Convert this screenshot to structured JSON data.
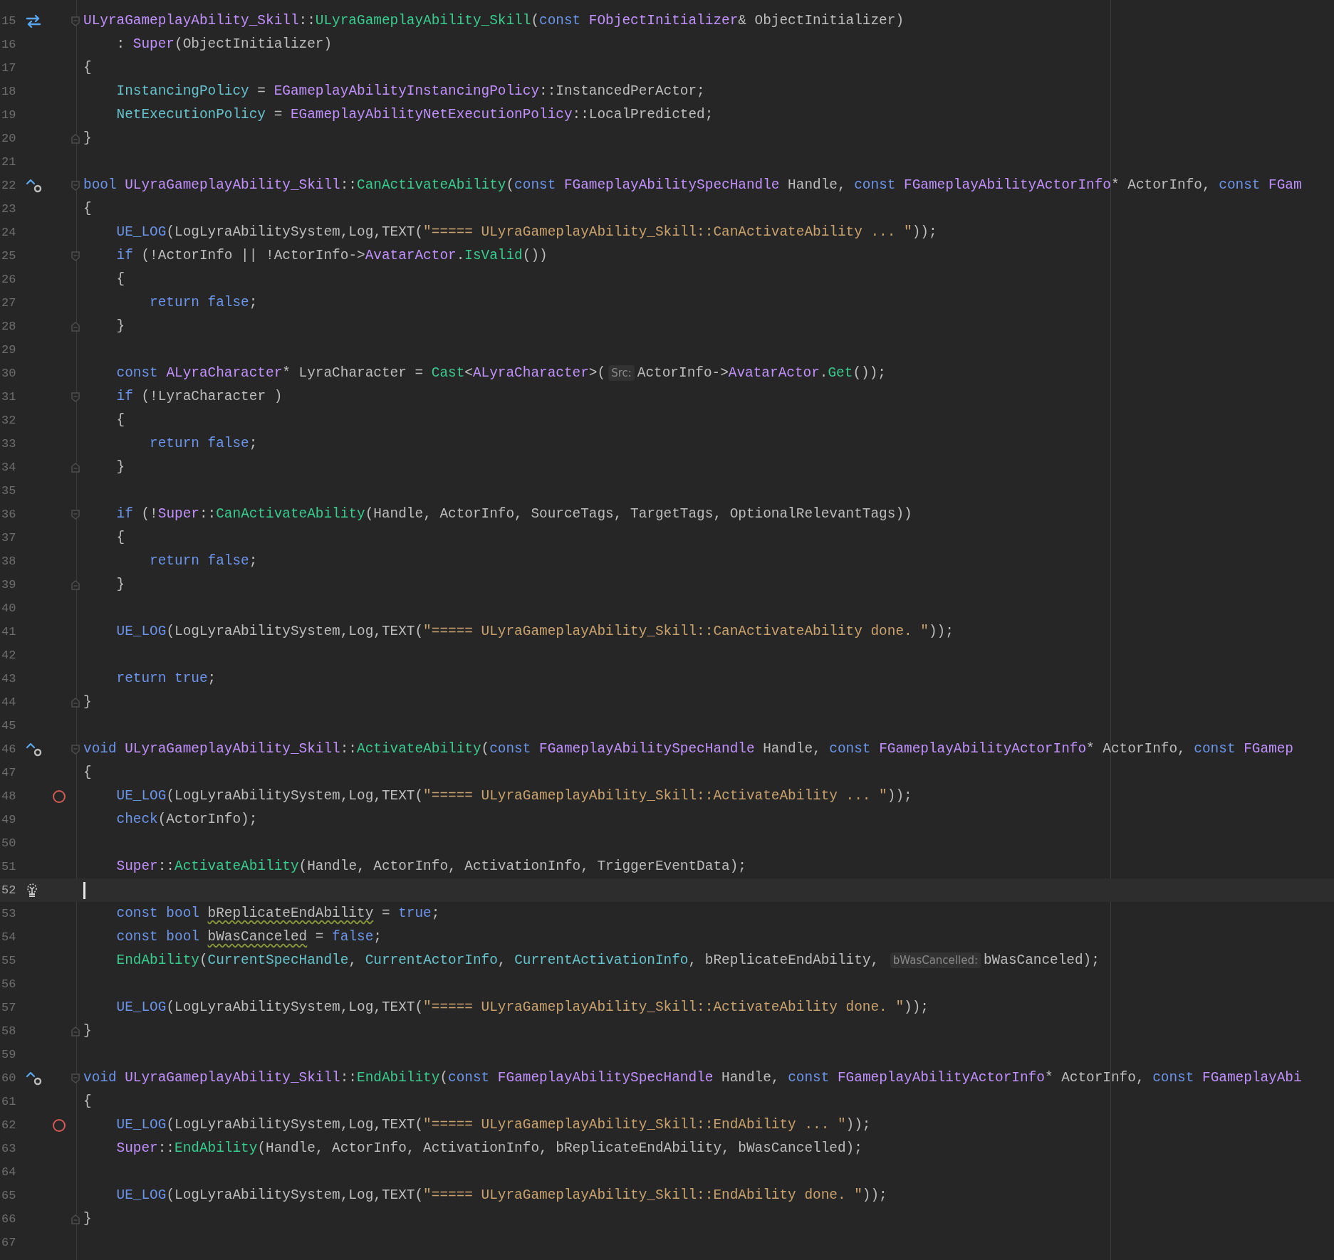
{
  "editor": {
    "lines": [
      {
        "number": "15",
        "gutter_icon": {
          "kind": "swap"
        },
        "fold": {
          "kind": "start"
        },
        "tokens": [
          {
            "kind": "cls",
            "text": "ULyraGameplayAbility_Skill"
          },
          {
            "kind": "plain",
            "text": "::"
          },
          {
            "kind": "fn",
            "text": "ULyraGameplayAbility_Skill"
          },
          {
            "kind": "plain",
            "text": "("
          },
          {
            "kind": "kw",
            "text": "const "
          },
          {
            "kind": "cls",
            "text": "FObjectInitializer"
          },
          {
            "kind": "plain",
            "text": "& ObjectInitializer)"
          }
        ]
      },
      {
        "number": "16",
        "tokens": [
          {
            "kind": "plain",
            "text": "    : "
          },
          {
            "kind": "cls",
            "text": "Super"
          },
          {
            "kind": "plain",
            "text": "(ObjectInitializer)"
          }
        ]
      },
      {
        "number": "17",
        "tokens": [
          {
            "kind": "plain",
            "text": "{"
          }
        ]
      },
      {
        "number": "18",
        "tokens": [
          {
            "kind": "field",
            "text": "    InstancingPolicy"
          },
          {
            "kind": "plain",
            "text": " = "
          },
          {
            "kind": "cls",
            "text": "EGameplayAbilityInstancingPolicy"
          },
          {
            "kind": "plain",
            "text": "::InstancedPerActor;"
          }
        ]
      },
      {
        "number": "19",
        "tokens": [
          {
            "kind": "field",
            "text": "    NetExecutionPolicy"
          },
          {
            "kind": "plain",
            "text": " = "
          },
          {
            "kind": "cls",
            "text": "EGameplayAbilityNetExecutionPolicy"
          },
          {
            "kind": "plain",
            "text": "::LocalPredicted;"
          }
        ]
      },
      {
        "number": "20",
        "fold": {
          "kind": "end"
        },
        "tokens": [
          {
            "kind": "plain",
            "text": "}"
          }
        ]
      },
      {
        "number": "21"
      },
      {
        "number": "22",
        "gutter_icon": {
          "kind": "override"
        },
        "fold": {
          "kind": "start"
        },
        "tokens": [
          {
            "kind": "kw",
            "text": "bool "
          },
          {
            "kind": "cls",
            "text": "ULyraGameplayAbility_Skill"
          },
          {
            "kind": "plain",
            "text": "::"
          },
          {
            "kind": "fn",
            "text": "CanActivateAbility"
          },
          {
            "kind": "plain",
            "text": "("
          },
          {
            "kind": "kw",
            "text": "const "
          },
          {
            "kind": "cls",
            "text": "FGameplayAbilitySpecHandle"
          },
          {
            "kind": "plain",
            "text": " Handle, "
          },
          {
            "kind": "kw",
            "text": "const "
          },
          {
            "kind": "cls",
            "text": "FGameplayAbilityActorInfo"
          },
          {
            "kind": "plain",
            "text": "* ActorInfo, "
          },
          {
            "kind": "kw",
            "text": "const "
          },
          {
            "kind": "cls",
            "text": "FGam"
          }
        ]
      },
      {
        "number": "23",
        "tokens": [
          {
            "kind": "plain",
            "text": "{"
          }
        ]
      },
      {
        "number": "24",
        "tokens": [
          {
            "kind": "macro",
            "text": "    UE_LOG"
          },
          {
            "kind": "plain",
            "text": "(LogLyraAbilitySystem,Log,TEXT("
          },
          {
            "kind": "str",
            "text": "\"===== ULyraGameplayAbility_Skill::CanActivateAbility ... \""
          },
          {
            "kind": "plain",
            "text": "));"
          }
        ]
      },
      {
        "number": "25",
        "fold": {
          "kind": "start"
        },
        "tokens": [
          {
            "kind": "kw",
            "text": "    if "
          },
          {
            "kind": "plain",
            "text": "(!ActorInfo || !ActorInfo->"
          },
          {
            "kind": "cls",
            "text": "AvatarActor"
          },
          {
            "kind": "plain",
            "text": "."
          },
          {
            "kind": "fn",
            "text": "IsValid"
          },
          {
            "kind": "plain",
            "text": "())"
          }
        ]
      },
      {
        "number": "26",
        "tokens": [
          {
            "kind": "plain",
            "text": "    {"
          }
        ]
      },
      {
        "number": "27",
        "tokens": [
          {
            "kind": "kw",
            "text": "        return false"
          },
          {
            "kind": "plain",
            "text": ";"
          }
        ]
      },
      {
        "number": "28",
        "fold": {
          "kind": "end"
        },
        "tokens": [
          {
            "kind": "plain",
            "text": "    }"
          }
        ]
      },
      {
        "number": "29"
      },
      {
        "number": "30",
        "tokens": [
          {
            "kind": "kw",
            "text": "    const "
          },
          {
            "kind": "cls",
            "text": "ALyraCharacter"
          },
          {
            "kind": "plain",
            "text": "* LyraCharacter = "
          },
          {
            "kind": "fn",
            "text": "Cast"
          },
          {
            "kind": "plain",
            "text": "<"
          },
          {
            "kind": "cls",
            "text": "ALyraCharacter"
          },
          {
            "kind": "plain",
            "text": ">("
          },
          {
            "kind": "hint",
            "text": "Src:"
          },
          {
            "kind": "plain",
            "text": "ActorInfo->"
          },
          {
            "kind": "cls",
            "text": "AvatarActor"
          },
          {
            "kind": "plain",
            "text": "."
          },
          {
            "kind": "fn",
            "text": "Get"
          },
          {
            "kind": "plain",
            "text": "());"
          }
        ]
      },
      {
        "number": "31",
        "fold": {
          "kind": "start"
        },
        "tokens": [
          {
            "kind": "kw",
            "text": "    if "
          },
          {
            "kind": "plain",
            "text": "(!LyraCharacter )"
          }
        ]
      },
      {
        "number": "32",
        "tokens": [
          {
            "kind": "plain",
            "text": "    {"
          }
        ]
      },
      {
        "number": "33",
        "tokens": [
          {
            "kind": "kw",
            "text": "        return false"
          },
          {
            "kind": "plain",
            "text": ";"
          }
        ]
      },
      {
        "number": "34",
        "fold": {
          "kind": "end"
        },
        "tokens": [
          {
            "kind": "plain",
            "text": "    }"
          }
        ]
      },
      {
        "number": "35"
      },
      {
        "number": "36",
        "fold": {
          "kind": "start"
        },
        "tokens": [
          {
            "kind": "kw",
            "text": "    if "
          },
          {
            "kind": "plain",
            "text": "(!"
          },
          {
            "kind": "cls",
            "text": "Super"
          },
          {
            "kind": "plain",
            "text": "::"
          },
          {
            "kind": "fn",
            "text": "CanActivateAbility"
          },
          {
            "kind": "plain",
            "text": "(Handle, ActorInfo, SourceTags, TargetTags, OptionalRelevantTags))"
          }
        ]
      },
      {
        "number": "37",
        "tokens": [
          {
            "kind": "plain",
            "text": "    {"
          }
        ]
      },
      {
        "number": "38",
        "tokens": [
          {
            "kind": "kw",
            "text": "        return false"
          },
          {
            "kind": "plain",
            "text": ";"
          }
        ]
      },
      {
        "number": "39",
        "fold": {
          "kind": "end"
        },
        "tokens": [
          {
            "kind": "plain",
            "text": "    }"
          }
        ]
      },
      {
        "number": "40"
      },
      {
        "number": "41",
        "tokens": [
          {
            "kind": "macro",
            "text": "    UE_LOG"
          },
          {
            "kind": "plain",
            "text": "(LogLyraAbilitySystem,Log,TEXT("
          },
          {
            "kind": "str",
            "text": "\"===== ULyraGameplayAbility_Skill::CanActivateAbility done. \""
          },
          {
            "kind": "plain",
            "text": "));"
          }
        ]
      },
      {
        "number": "42"
      },
      {
        "number": "43",
        "tokens": [
          {
            "kind": "kw",
            "text": "    return true"
          },
          {
            "kind": "plain",
            "text": ";"
          }
        ]
      },
      {
        "number": "44",
        "fold": {
          "kind": "end"
        },
        "tokens": [
          {
            "kind": "plain",
            "text": "}"
          }
        ]
      },
      {
        "number": "45"
      },
      {
        "number": "46",
        "gutter_icon": {
          "kind": "override"
        },
        "fold": {
          "kind": "start"
        },
        "tokens": [
          {
            "kind": "kw",
            "text": "void "
          },
          {
            "kind": "cls",
            "text": "ULyraGameplayAbility_Skill"
          },
          {
            "kind": "plain",
            "text": "::"
          },
          {
            "kind": "fn",
            "text": "ActivateAbility"
          },
          {
            "kind": "plain",
            "text": "("
          },
          {
            "kind": "kw",
            "text": "const "
          },
          {
            "kind": "cls",
            "text": "FGameplayAbilitySpecHandle"
          },
          {
            "kind": "plain",
            "text": " Handle, "
          },
          {
            "kind": "kw",
            "text": "const "
          },
          {
            "kind": "cls",
            "text": "FGameplayAbilityActorInfo"
          },
          {
            "kind": "plain",
            "text": "* ActorInfo, "
          },
          {
            "kind": "kw",
            "text": "const "
          },
          {
            "kind": "cls",
            "text": "FGamep"
          }
        ]
      },
      {
        "number": "47",
        "tokens": [
          {
            "kind": "plain",
            "text": "{"
          }
        ]
      },
      {
        "number": "48",
        "gutter_icon": {
          "kind": "breakpoint"
        },
        "tokens": [
          {
            "kind": "macro",
            "text": "    UE_LOG"
          },
          {
            "kind": "plain",
            "text": "(LogLyraAbilitySystem,Log,TEXT("
          },
          {
            "kind": "str",
            "text": "\"===== ULyraGameplayAbility_Skill::ActivateAbility ... \""
          },
          {
            "kind": "plain",
            "text": "));"
          }
        ]
      },
      {
        "number": "49",
        "tokens": [
          {
            "kind": "macro",
            "text": "    check"
          },
          {
            "kind": "plain",
            "text": "(ActorInfo);"
          }
        ]
      },
      {
        "number": "50"
      },
      {
        "number": "51",
        "tokens": [
          {
            "kind": "cls",
            "text": "    Super"
          },
          {
            "kind": "plain",
            "text": "::"
          },
          {
            "kind": "fn",
            "text": "ActivateAbility"
          },
          {
            "kind": "plain",
            "text": "(Handle, ActorInfo, ActivationInfo, TriggerEventData);"
          }
        ]
      },
      {
        "number": "52",
        "gutter_icon": {
          "kind": "bulb"
        },
        "current": true
      },
      {
        "number": "53",
        "tokens": [
          {
            "kind": "kw",
            "text": "    const bool "
          },
          {
            "kind": "warn",
            "text": "bReplicateEndAbility"
          },
          {
            "kind": "plain",
            "text": " = "
          },
          {
            "kind": "kw",
            "text": "true"
          },
          {
            "kind": "plain",
            "text": ";"
          }
        ]
      },
      {
        "number": "54",
        "tokens": [
          {
            "kind": "kw",
            "text": "    const bool "
          },
          {
            "kind": "warn",
            "text": "bWasCanceled"
          },
          {
            "kind": "plain",
            "text": " = "
          },
          {
            "kind": "kw",
            "text": "false"
          },
          {
            "kind": "plain",
            "text": ";"
          }
        ]
      },
      {
        "number": "55",
        "tokens": [
          {
            "kind": "fn",
            "text": "    EndAbility"
          },
          {
            "kind": "plain",
            "text": "("
          },
          {
            "kind": "field",
            "text": "CurrentSpecHandle"
          },
          {
            "kind": "plain",
            "text": ", "
          },
          {
            "kind": "field",
            "text": "CurrentActorInfo"
          },
          {
            "kind": "plain",
            "text": ", "
          },
          {
            "kind": "field",
            "text": "CurrentActivationInfo"
          },
          {
            "kind": "plain",
            "text": ", bReplicateEndAbility, "
          },
          {
            "kind": "hint",
            "text": "bWasCancelled:"
          },
          {
            "kind": "plain",
            "text": "bWasCanceled);"
          }
        ]
      },
      {
        "number": "56"
      },
      {
        "number": "57",
        "tokens": [
          {
            "kind": "macro",
            "text": "    UE_LOG"
          },
          {
            "kind": "plain",
            "text": "(LogLyraAbilitySystem,Log,TEXT("
          },
          {
            "kind": "str",
            "text": "\"===== ULyraGameplayAbility_Skill::ActivateAbility done. \""
          },
          {
            "kind": "plain",
            "text": "));"
          }
        ]
      },
      {
        "number": "58",
        "fold": {
          "kind": "end"
        },
        "tokens": [
          {
            "kind": "plain",
            "text": "}"
          }
        ]
      },
      {
        "number": "59"
      },
      {
        "number": "60",
        "gutter_icon": {
          "kind": "override"
        },
        "fold": {
          "kind": "start"
        },
        "tokens": [
          {
            "kind": "kw",
            "text": "void "
          },
          {
            "kind": "cls",
            "text": "ULyraGameplayAbility_Skill"
          },
          {
            "kind": "plain",
            "text": "::"
          },
          {
            "kind": "fn",
            "text": "EndAbility"
          },
          {
            "kind": "plain",
            "text": "("
          },
          {
            "kind": "kw",
            "text": "const "
          },
          {
            "kind": "cls",
            "text": "FGameplayAbilitySpecHandle"
          },
          {
            "kind": "plain",
            "text": " Handle, "
          },
          {
            "kind": "kw",
            "text": "const "
          },
          {
            "kind": "cls",
            "text": "FGameplayAbilityActorInfo"
          },
          {
            "kind": "plain",
            "text": "* ActorInfo, "
          },
          {
            "kind": "kw",
            "text": "const "
          },
          {
            "kind": "cls",
            "text": "FGameplayAbi"
          }
        ]
      },
      {
        "number": "61",
        "tokens": [
          {
            "kind": "plain",
            "text": "{"
          }
        ]
      },
      {
        "number": "62",
        "gutter_icon": {
          "kind": "breakpoint"
        },
        "tokens": [
          {
            "kind": "macro",
            "text": "    UE_LOG"
          },
          {
            "kind": "plain",
            "text": "(LogLyraAbilitySystem,Log,TEXT("
          },
          {
            "kind": "str",
            "text": "\"===== ULyraGameplayAbility_Skill::EndAbility ... \""
          },
          {
            "kind": "plain",
            "text": "));"
          }
        ]
      },
      {
        "number": "63",
        "tokens": [
          {
            "kind": "cls",
            "text": "    Super"
          },
          {
            "kind": "plain",
            "text": "::"
          },
          {
            "kind": "fn",
            "text": "EndAbility"
          },
          {
            "kind": "plain",
            "text": "(Handle, ActorInfo, ActivationInfo, bReplicateEndAbility, bWasCancelled);"
          }
        ]
      },
      {
        "number": "64"
      },
      {
        "number": "65",
        "tokens": [
          {
            "kind": "macro",
            "text": "    UE_LOG"
          },
          {
            "kind": "plain",
            "text": "(LogLyraAbilitySystem,Log,TEXT("
          },
          {
            "kind": "str",
            "text": "\"===== ULyraGameplayAbility_Skill::EndAbility done. \""
          },
          {
            "kind": "plain",
            "text": "));"
          }
        ]
      },
      {
        "number": "66",
        "fold": {
          "kind": "end"
        },
        "tokens": [
          {
            "kind": "plain",
            "text": "}"
          }
        ]
      },
      {
        "number": "67"
      }
    ]
  }
}
